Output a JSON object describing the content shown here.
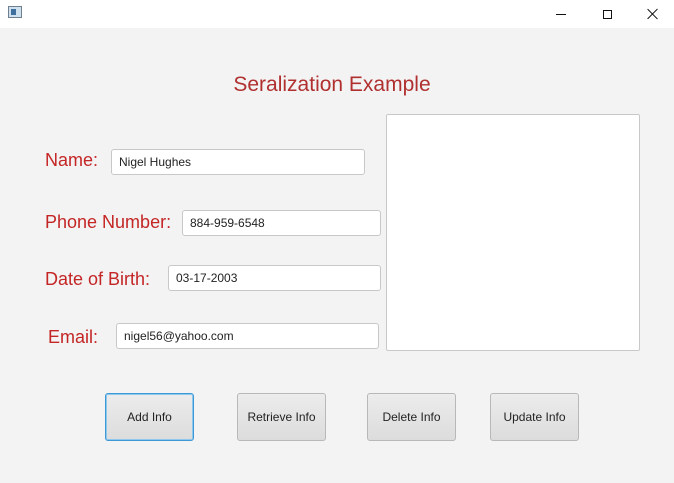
{
  "window": {
    "icon": "java-app-icon",
    "controls": {
      "minimize": "minimize-icon",
      "maximize": "maximize-icon",
      "close": "close-icon"
    }
  },
  "heading": "Seralization Example",
  "form": {
    "name_label": "Name:",
    "name_value": "Nigel Hughes",
    "phone_label": "Phone Number:",
    "phone_value": "884-959-6548",
    "dob_label": "Date of Birth:",
    "dob_value": "03-17-2003",
    "email_label": "Email:",
    "email_value": "nigel56@yahoo.com"
  },
  "output_area": {
    "value": ""
  },
  "buttons": {
    "add": "Add Info",
    "retrieve": "Retrieve Info",
    "delete": "Delete Info",
    "update": "Update Info"
  },
  "colors": {
    "label": "#c42525",
    "heading": "#b03030",
    "focus": "#3d98d6"
  }
}
